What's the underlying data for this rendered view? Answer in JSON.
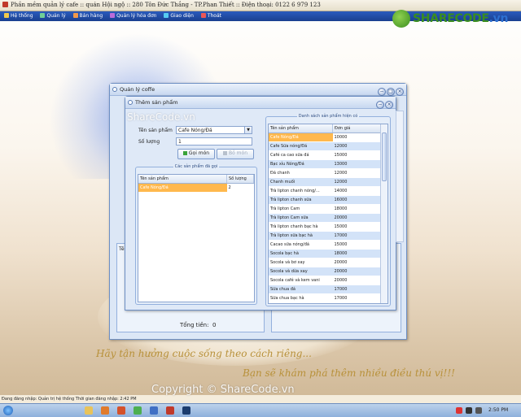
{
  "app_title": "Phần mềm quản lý cafe  :: quán Hội ngộ  :: 280 Tôn Đức Thắng - TP.Phan Thiết  :: Điện thoại: 0122 6 979 123",
  "logo": {
    "brand": "SHARECODE",
    "domain": ".vn"
  },
  "menu": [
    {
      "label": "Hệ thống",
      "icon": "system-icon"
    },
    {
      "label": "Quản lý",
      "icon": "manage-icon"
    },
    {
      "label": "Bán hàng",
      "icon": "sales-icon"
    },
    {
      "label": "Quản lý hóa đơn",
      "icon": "invoice-icon"
    },
    {
      "label": "Giao diện",
      "icon": "theme-icon"
    },
    {
      "label": "Thoát",
      "icon": "exit-icon"
    }
  ],
  "outer_window": {
    "title": "Quản lý coffe",
    "hidden_left_label": "Tê",
    "total_label": "Tổng tiền:",
    "total_value": "0"
  },
  "dialog": {
    "title": "Thêm sản phẩm",
    "watermark": "ShareCode.vn",
    "product_label": "Tên sản phẩm",
    "product_value": "Cafe Nóng/Đá",
    "qty_label": "Số lượng",
    "qty_value": "1",
    "order_button": "Gọi món",
    "remove_button": "Bỏ món",
    "ordered_group": "Các sản phẩm đã gọi",
    "ordered_columns": [
      "Tên sản phẩm",
      "Số lượng"
    ],
    "ordered_rows": [
      {
        "name": "Cafe Nóng/Đá",
        "qty": "2"
      }
    ],
    "available_group": "Danh sách sản phẩm hiện có",
    "available_columns": [
      "Tên sản phẩm",
      "Đơn giá"
    ],
    "available_rows": [
      {
        "name": "Cafe Nóng/Đá",
        "price": "10000"
      },
      {
        "name": "Cafe Sữa nóng/Đá",
        "price": "12000"
      },
      {
        "name": "Café ca cao sữa đá",
        "price": "15000"
      },
      {
        "name": "Bạc xỉu Nóng/Đá",
        "price": "13000"
      },
      {
        "name": "Đá chanh",
        "price": "12000"
      },
      {
        "name": "Chanh muối",
        "price": "12000"
      },
      {
        "name": "Trà lipton chanh nóng/...",
        "price": "14000"
      },
      {
        "name": "Trà lipton chanh sữa",
        "price": "16000"
      },
      {
        "name": "Trà lipton Cam",
        "price": "18000"
      },
      {
        "name": "Trà lipton Cam sữa",
        "price": "20000"
      },
      {
        "name": "Trà lipton chanh bạc hà",
        "price": "15000"
      },
      {
        "name": "Trà lipton sữa bạc hà",
        "price": "17000"
      },
      {
        "name": "Cacao sữa nóng/đá",
        "price": "15000"
      },
      {
        "name": "Socola bạc hà",
        "price": "18000"
      },
      {
        "name": "Socola và bơ xay",
        "price": "20000"
      },
      {
        "name": "Socola và dừa xay",
        "price": "20000"
      },
      {
        "name": "Socola café và kem vani",
        "price": "20000"
      },
      {
        "name": "Sữa chua đá",
        "price": "17000"
      },
      {
        "name": "Sữa chua bạc hà",
        "price": "17000"
      }
    ]
  },
  "statusbar": "Đang đăng nhập: Quản trị hệ thống   Thời gian đăng nhập: 2:42 PM",
  "copyright": "Copyright © ShareCode.vn",
  "poem": {
    "line1": "Hãy tận hưởng cuộc sống theo cách riêng...",
    "line2": "Bạn sẽ khám phá thêm nhiều điều thú vị!!!"
  },
  "clock": "2:50 PM",
  "colors": {
    "menubar": "#1a3f8f",
    "selection": "#ffb84d",
    "row_alt": "#d3e3f8"
  }
}
